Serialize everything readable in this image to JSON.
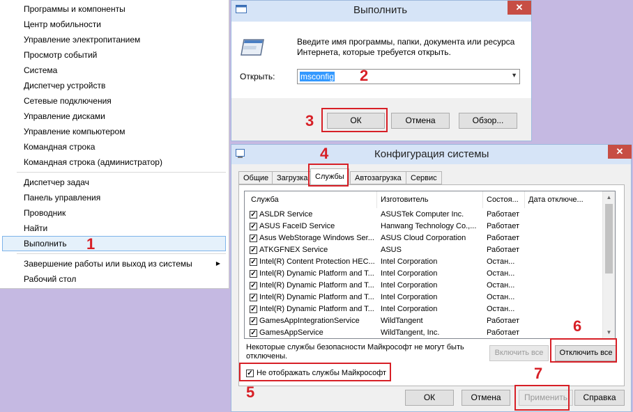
{
  "winx_menu": {
    "group1": [
      "Программы и компоненты",
      "Центр мобильности",
      "Управление электропитанием",
      "Просмотр событий",
      "Система",
      "Диспетчер устройств",
      "Сетевые подключения",
      "Управление дисками",
      "Управление компьютером",
      "Командная строка",
      "Командная строка (администратор)"
    ],
    "group2": [
      "Диспетчер задач",
      "Панель управления",
      "Проводник",
      "Найти",
      "Выполнить"
    ],
    "group3": [
      "Завершение работы или выход из системы",
      "Рабочий стол"
    ],
    "highlighted": "Выполнить"
  },
  "run_dialog": {
    "title": "Выполнить",
    "description_line1": "Введите имя программы, папки, документа или ресурса",
    "description_line2": "Интернета, которые требуется открыть.",
    "open_label": "Открыть:",
    "input_value": "msconfig",
    "ok": "ОК",
    "cancel": "Отмена",
    "browse": "Обзор..."
  },
  "msconfig": {
    "title": "Конфигурация системы",
    "tabs": [
      "Общие",
      "Загрузка",
      "Службы",
      "Автозагрузка",
      "Сервис"
    ],
    "active_tab": "Службы",
    "columns": [
      "Служба",
      "Изготовитель",
      "Состоя...",
      "Дата отключе..."
    ],
    "services": [
      {
        "name": "ASLDR Service",
        "maker": "ASUSTek Computer Inc.",
        "state": "Работает"
      },
      {
        "name": "ASUS FaceID Service",
        "maker": "Hanwang Technology Co.,...",
        "state": "Работает"
      },
      {
        "name": "Asus WebStorage Windows Ser...",
        "maker": "ASUS Cloud Corporation",
        "state": "Работает"
      },
      {
        "name": "ATKGFNEX Service",
        "maker": "ASUS",
        "state": "Работает"
      },
      {
        "name": "Intel(R) Content Protection HEC...",
        "maker": "Intel Corporation",
        "state": "Остан..."
      },
      {
        "name": "Intel(R) Dynamic Platform and T...",
        "maker": "Intel Corporation",
        "state": "Остан..."
      },
      {
        "name": "Intel(R) Dynamic Platform and T...",
        "maker": "Intel Corporation",
        "state": "Остан..."
      },
      {
        "name": "Intel(R) Dynamic Platform and T...",
        "maker": "Intel Corporation",
        "state": "Остан..."
      },
      {
        "name": "Intel(R) Dynamic Platform and T...",
        "maker": "Intel Corporation",
        "state": "Остан..."
      },
      {
        "name": "GamesAppIntegrationService",
        "maker": "WildTangent",
        "state": "Работает"
      },
      {
        "name": "GamesAppService",
        "maker": "WildTangent, Inc.",
        "state": "Работает"
      }
    ],
    "note_line1": "Некоторые службы безопасности Майкрософт не могут быть",
    "note_line2": "отключены.",
    "enable_all": "Включить все",
    "disable_all": "Отключить все",
    "hide_ms_label": "Не отображать службы Майкрософт",
    "ok": "ОК",
    "cancel": "Отмена",
    "apply": "Применить",
    "help": "Справка"
  },
  "steps": [
    "1",
    "2",
    "3",
    "4",
    "5",
    "6",
    "7"
  ],
  "colors": {
    "accent_red": "#d71f26",
    "highlight": "#e5f1fb",
    "title_bar": "#d6e4f7",
    "close": "#c74e44"
  }
}
